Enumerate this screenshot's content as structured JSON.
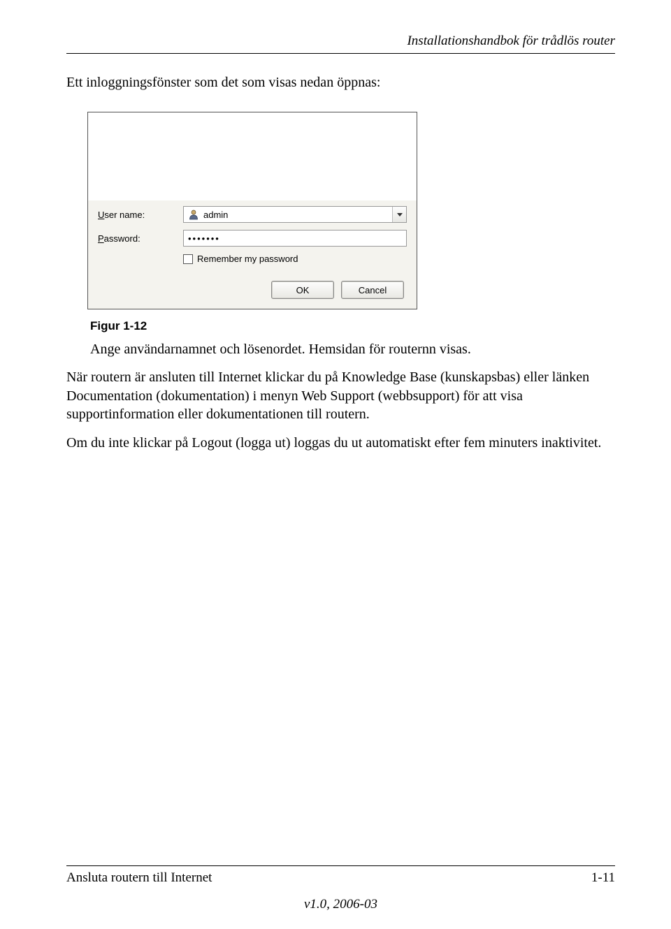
{
  "header": {
    "title": "Installationshandbok för trådlös router"
  },
  "intro": "Ett inloggningsfönster som det som visas nedan öppnas:",
  "dialog": {
    "user_label_pre": "U",
    "user_label_post": "ser name:",
    "password_label_pre": "P",
    "password_label_post": "assword:",
    "user_value": "admin",
    "password_value": "•••••••",
    "remember_label": "Remember my password",
    "ok_label": "OK",
    "cancel_label": "Cancel"
  },
  "figure_caption": "Figur 1-12",
  "p1": "Ange användarnamnet och lösenordet. Hemsidan för routernn visas.",
  "p2": "När routern är ansluten till Internet klickar du på Knowledge Base (kunskapsbas) eller länken Documentation (dokumentation) i menyn Web Support (webbsupport) för att visa supportinformation eller dokumentationen till routern.",
  "p3": "Om du inte klickar på Logout (logga ut) loggas du ut automatiskt efter fem minuters inaktivitet.",
  "footer": {
    "left": "Ansluta routern till Internet",
    "right": "1-11",
    "center": "v1.0, 2006-03"
  }
}
